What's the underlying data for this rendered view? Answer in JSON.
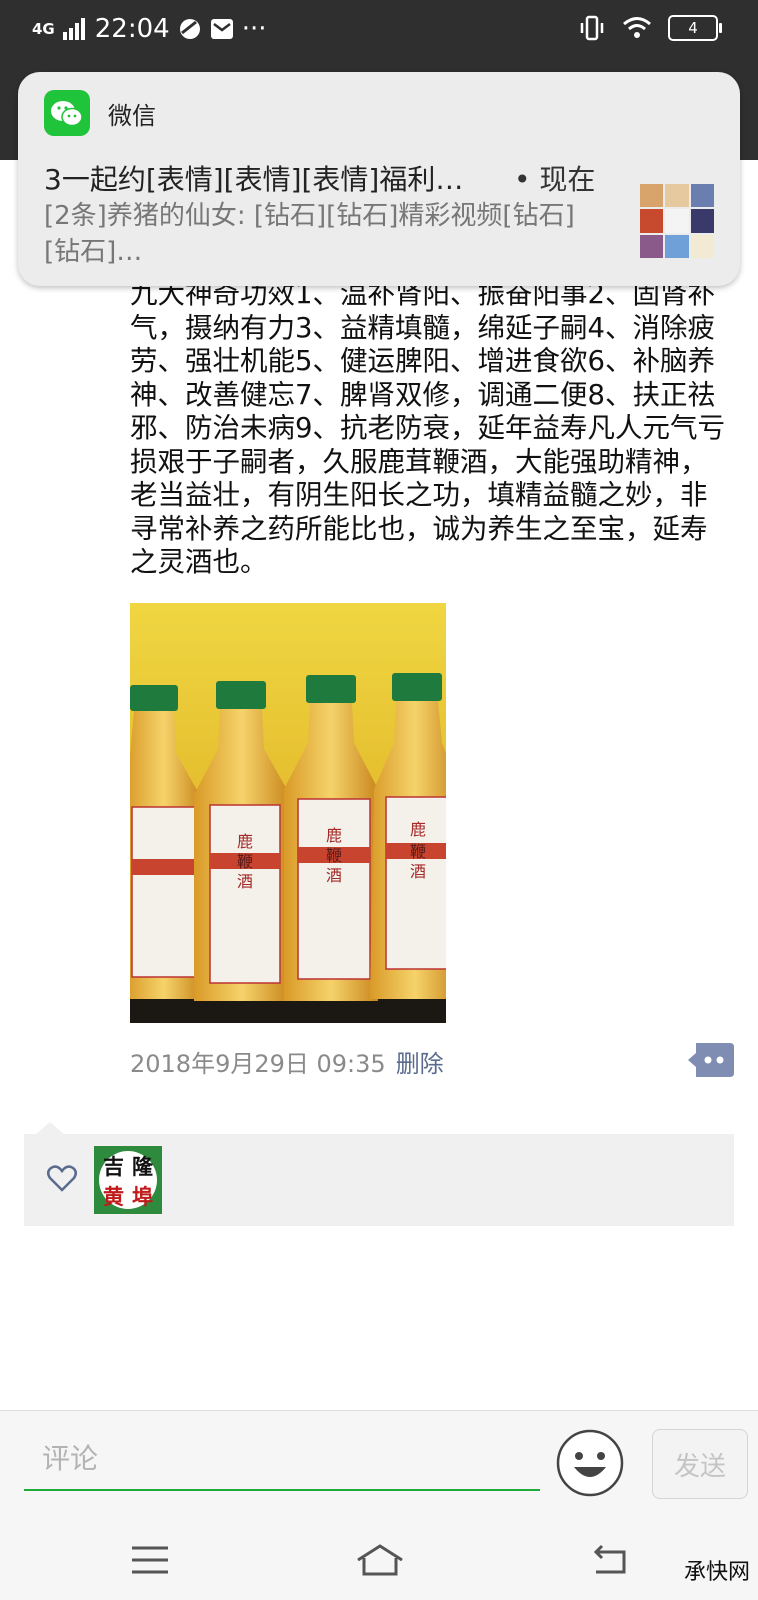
{
  "status_bar": {
    "network": "4G",
    "time": "22:04",
    "more": "···",
    "battery": "4"
  },
  "notification": {
    "app_name": "微信",
    "title": "3一起约[表情][表情][表情]福利…",
    "time": "• 现在",
    "body": "[2条]养猪的仙女: [钻石][钻石]精彩视频[钻石][钻石]…"
  },
  "post": {
    "text": "九大神奇功效1、温补肾阳、振奋阳事2、固肾补气，摄纳有力3、益精填髓，绵延子嗣4、消除疲劳、强壮机能5、健运脾阳、增进食欲6、补脑养神、改善健忘7、脾肾双修，调通二便8、扶正祛邪、防治未病9、抗老防衰，延年益寿凡人元气亏损艰于子嗣者，久服鹿茸鞭酒，大能强助精神，老当益壮，有阴生阳长之功，填精益髓之妙，非寻常补养之药所能比也，诚为养生之至宝，延寿之灵酒也。",
    "timestamp": "2018年9月29日 09:35",
    "delete_label": "删除"
  },
  "likes": {
    "liker_avatar_text": [
      "吉",
      "隆",
      "黄",
      "埠"
    ]
  },
  "comment": {
    "placeholder": "评论",
    "send_label": "发送"
  },
  "watermark": "承快网",
  "colors": {
    "wechat_green": "#1fc43b",
    "input_underline": "#1faa3a",
    "link": "#5a6b8e"
  }
}
